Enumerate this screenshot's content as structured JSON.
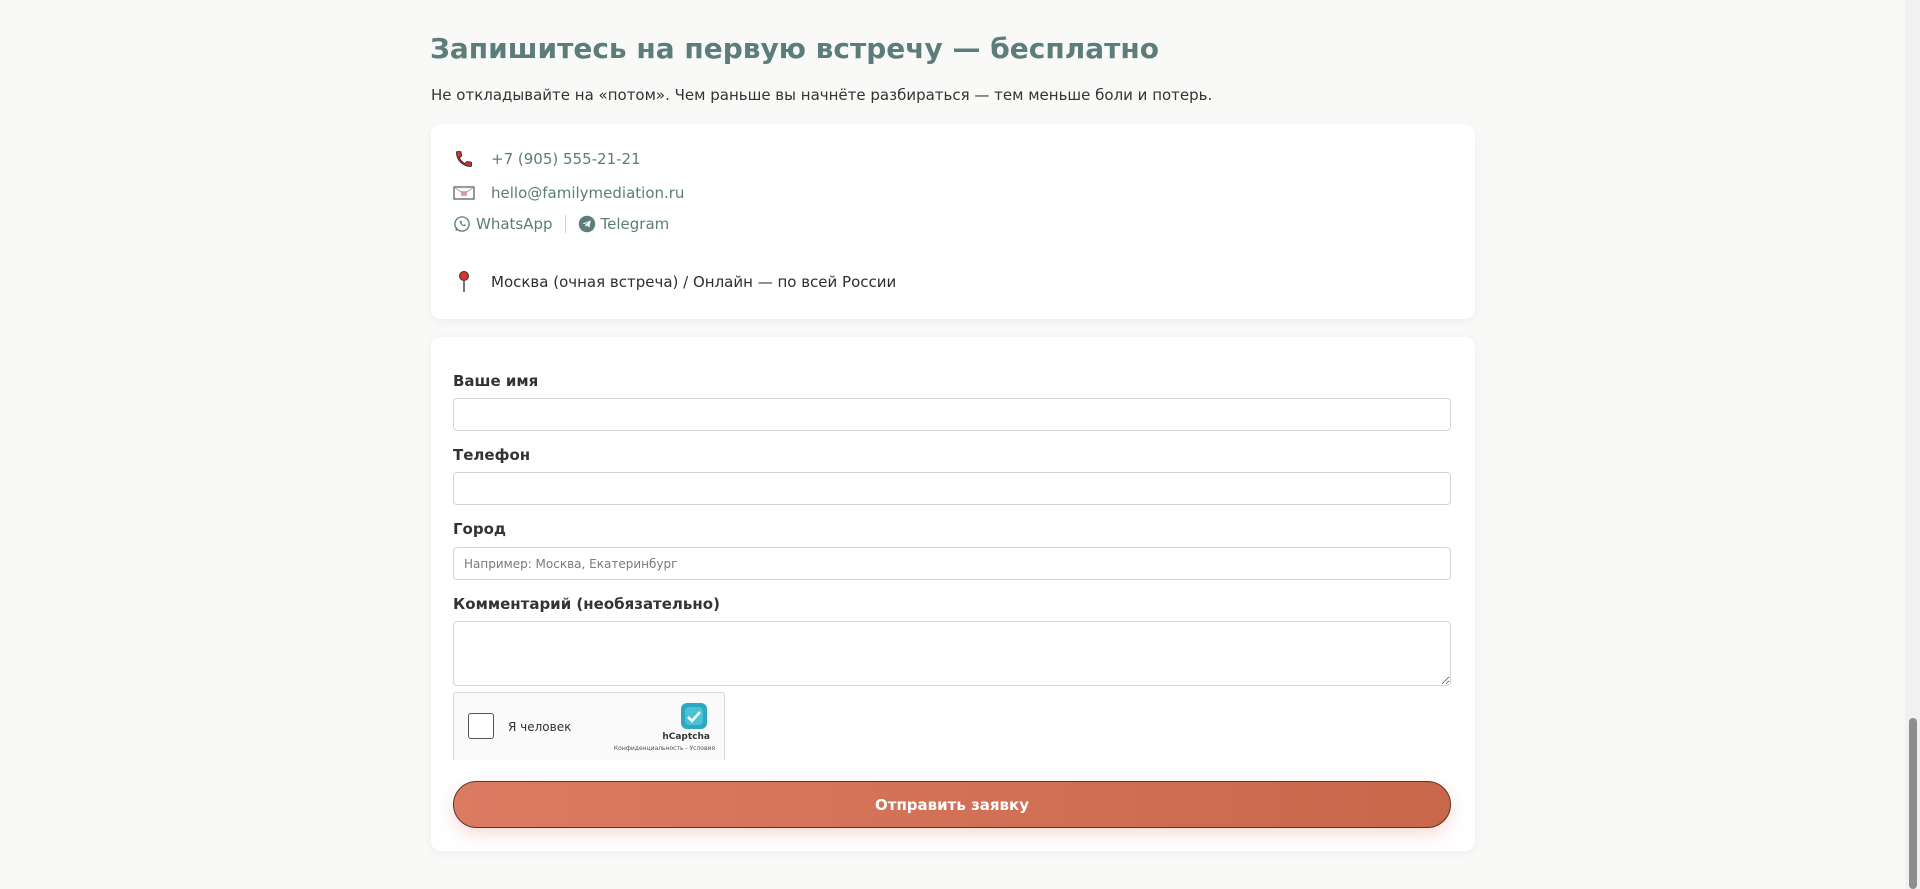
{
  "section": {
    "title": "Запишитесь на первую встречу — бесплатно",
    "subtitle": "Не откладывайте на «потом». Чем раньше вы начнёте разбираться — тем меньше боли и потерь."
  },
  "contacts": {
    "phone": "+7 (905) 555-21-21",
    "email": "hello@familymediation.ru",
    "whatsapp": "WhatsApp",
    "telegram": "Telegram",
    "location": "Москва (очная встреча) / Онлайн — по всей России",
    "icons": [
      "phone-icon",
      "email-icon",
      "whatsapp-icon",
      "telegram-icon",
      "pin-icon"
    ]
  },
  "form": {
    "name_label": "Ваше имя",
    "name_value": "",
    "phone_label": "Телефон",
    "phone_value": "",
    "city_label": "Город",
    "city_placeholder": "Например: Москва, Екатеринбург",
    "comment_label": "Комментарий (необязательно)",
    "comment_value": "",
    "captcha_text": "Я человек",
    "captcha_brand": "hCaptcha",
    "captcha_terms": "Конфиденциальность - Условия",
    "submit_label": "Отправить заявку"
  },
  "colors": {
    "accent": "#5c7d7a",
    "button": "#d6735a",
    "background": "#f9f9f8"
  }
}
